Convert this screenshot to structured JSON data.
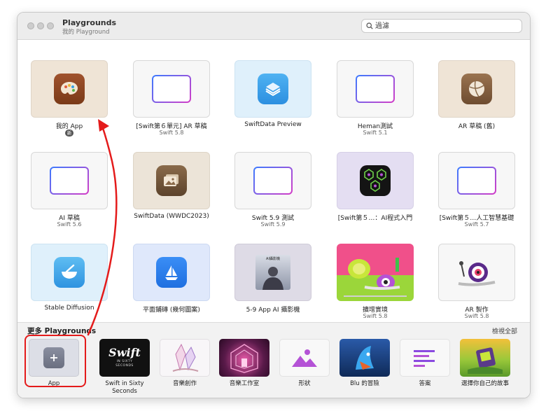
{
  "window": {
    "title": "Playgrounds",
    "subtitle": "我的 Playground"
  },
  "search": {
    "placeholder": "過濾"
  },
  "playgrounds": [
    {
      "name": "我的 App",
      "version": "",
      "badge": "新",
      "thumb": "palette-icon"
    },
    {
      "name": "[Swift第６單元] AR 草稿",
      "version": "Swift 5.8",
      "thumb": "frame"
    },
    {
      "name": "SwiftData Preview",
      "version": "",
      "thumb": "sandwich-icon"
    },
    {
      "name": "Heman測試",
      "version": "Swift 5.1",
      "thumb": "frame"
    },
    {
      "name": "AR 草稿 (舊)",
      "version": "",
      "thumb": "ball-icon"
    },
    {
      "name": "AI 草稿",
      "version": "Swift 5.6",
      "thumb": "frame"
    },
    {
      "name": "SwiftData (WWDC2023)",
      "version": "",
      "thumb": "photo-icon"
    },
    {
      "name": "Swift 5.9 測試",
      "version": "Swift 5.9",
      "thumb": "frame"
    },
    {
      "name": "[Swift第５…：AI程式入門",
      "version": "",
      "thumb": "pattern-icon"
    },
    {
      "name": "[Swift第５…人工智慧基礎",
      "version": "Swift 5.7",
      "thumb": "frame"
    },
    {
      "name": "Stable Diffusion",
      "version": "",
      "thumb": "bowl-icon"
    },
    {
      "name": "平面鋪磚 (幾何圖案)",
      "version": "",
      "thumb": "sailboat-icon"
    },
    {
      "name": "5-9 App AI 攝影機",
      "version": "",
      "thumb": "camera-preview",
      "thumb_label": "AI攝影機"
    },
    {
      "name": "擴增實境",
      "version": "Swift 5.8",
      "thumb": "snail-scene"
    },
    {
      "name": "AR 製作",
      "version": "Swift 5.8",
      "thumb": "snail-icon"
    }
  ],
  "more": {
    "title": "更多 Playgrounds",
    "see_all": "檢視全部",
    "templates": [
      {
        "name": "App",
        "thumb": "plus-icon"
      },
      {
        "name": "Swift in Sixty Seconds",
        "thumb": "swift-sixty",
        "thumb_title": "Swift",
        "thumb_sub": "IN SIXTY SECONDS"
      },
      {
        "name": "音樂創作",
        "thumb": "crystal-icon"
      },
      {
        "name": "音樂工作室",
        "thumb": "stage-icon"
      },
      {
        "name": "形狀",
        "thumb": "shapes-icon"
      },
      {
        "name": "Blu 的冒險",
        "thumb": "blu-icon"
      },
      {
        "name": "答案",
        "thumb": "answers-icon"
      },
      {
        "name": "選擇你自己的故事",
        "thumb": "story-icon"
      }
    ]
  },
  "colors": {
    "annotation": "#e41b1b",
    "accent_gradient_start": "#3b7bff",
    "accent_gradient_end": "#d43cc7"
  }
}
